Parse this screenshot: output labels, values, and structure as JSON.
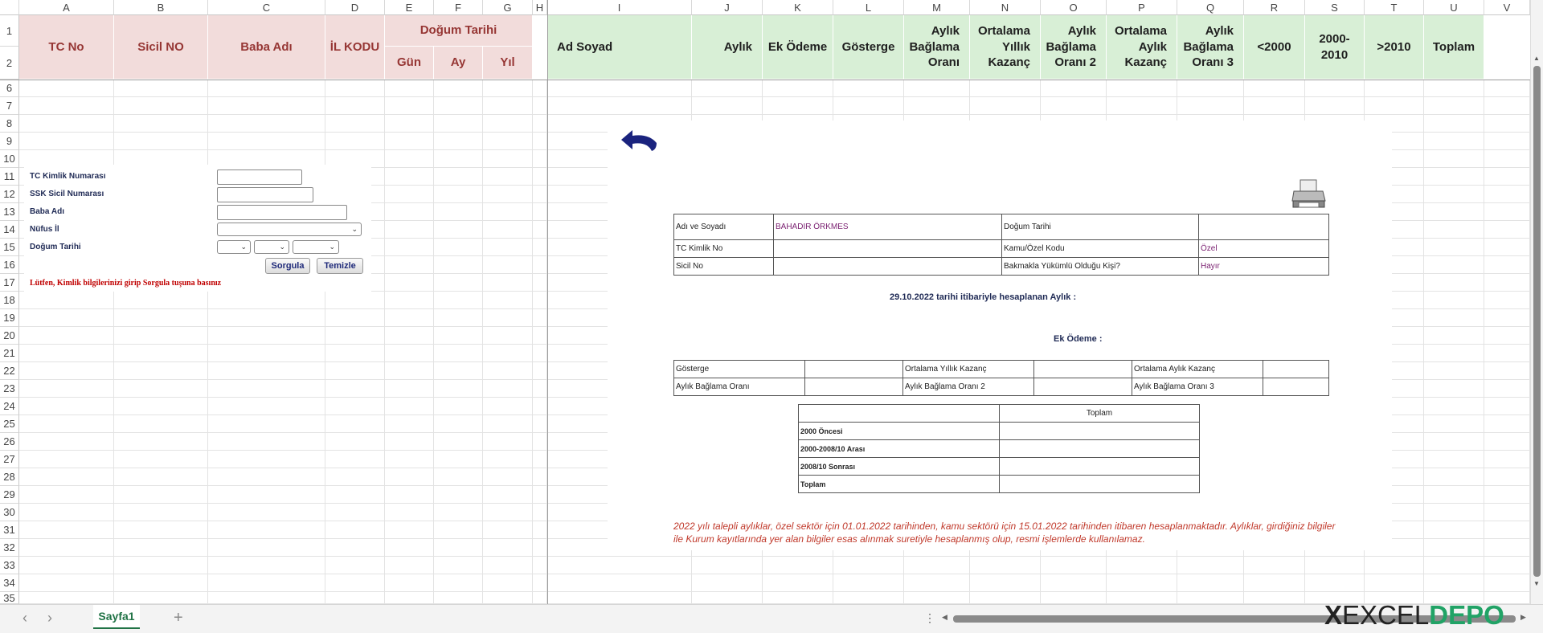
{
  "columns": [
    "A",
    "B",
    "C",
    "D",
    "E",
    "F",
    "G",
    "H",
    "I",
    "J",
    "K",
    "L",
    "M",
    "N",
    "O",
    "P",
    "Q",
    "R",
    "S",
    "T",
    "U",
    "V"
  ],
  "rows": [
    "1",
    "2",
    "6",
    "7",
    "8",
    "9",
    "10",
    "11",
    "12",
    "13",
    "14",
    "15",
    "16",
    "17",
    "18",
    "19",
    "20",
    "21",
    "22",
    "23",
    "24",
    "25",
    "26",
    "27",
    "28",
    "29",
    "30",
    "31",
    "32",
    "33",
    "34",
    "35"
  ],
  "headers": {
    "tc_no": "TC No",
    "sicil_no": "Sicil NO",
    "baba_adi": "Baba Adı",
    "il_kodu": "İL KODU",
    "dogum_tarihi": "Doğum Tarihi",
    "gun": "Gün",
    "ay": "Ay",
    "yil": "Yıl",
    "ad_soyad": "Ad Soyad",
    "aylik": "Aylık",
    "ek_odeme": "Ek Ödeme",
    "gosterge": "Gösterge",
    "aylik_baglama_orani": "Aylık Bağlama Oranı",
    "ortalama_yillik_kazanc": "Ortalama Yıllık Kazanç",
    "aylik_baglama_orani_2": "Aylık Bağlama Oranı 2",
    "ortalama_aylik_kazanc": "Ortalama Aylık Kazanç",
    "aylik_baglama_orani_3": "Aylık Bağlama Oranı 3",
    "lt2000": "<2000",
    "r2000_2010": "2000-2010",
    "gt2010": ">2010",
    "toplam": "Toplam"
  },
  "form": {
    "tc_label": "TC Kimlik Numarası",
    "ssk_label": "SSK Sicil Numarası",
    "baba_label": "Baba Adı",
    "nufus_label": "Nüfus İl",
    "dogum_label": "Doğum Tarihi",
    "sorgula": "Sorgula",
    "temizle": "Temizle",
    "hint": "Lütfen, Kimlik bilgilerinizi girip Sorgula tuşuna basınız",
    "dropdown_arrow": "⌄"
  },
  "report": {
    "ad_soyad_label": "Adı ve Soyadı",
    "ad_soyad_value": "BAHADIR ÖRKMES",
    "dogum_tarihi_label": "Doğum Tarihi",
    "tc_label": "TC Kimlik No",
    "kamu_ozel_label": "Kamu/Özel Kodu",
    "kamu_ozel_value": "Özel",
    "sicil_label": "Sicil No",
    "bakmakla_label": "Bakmakla Yükümlü Olduğu Kişi?",
    "bakmakla_value": "Hayır",
    "aylik_line": "29.10.2022 tarihi itibariyle hesaplanan Aylık :",
    "ek_odeme_line": "Ek Ödeme :",
    "gosterge": "Gösterge",
    "ortalama_yillik": "Ortalama Yıllık Kazanç",
    "ortalama_aylik": "Ortalama Aylık Kazanç",
    "abo": "Aylık Bağlama Oranı",
    "abo2": "Aylık Bağlama Oranı 2",
    "abo3": "Aylık Bağlama Oranı 3",
    "toplam_header": "Toplam",
    "r1": "2000 Öncesi",
    "r2": "2000-2008/10 Arası",
    "r3": "2008/10 Sonrası",
    "r4": "Toplam",
    "note": "2022 yılı talepli aylıklar, özel sektör için 01.01.2022 tarihinden, kamu sektörü için 15.01.2022 tarihinden itibaren hesaplanmaktadır. Aylıklar, girdiğiniz bilgiler ile Kurum kayıtlarında yer alan bilgiler esas alınmak suretiyle hesaplanmış olup, resmi işlemlerde kullanılamaz."
  },
  "sheet": {
    "tab": "Sayfa1",
    "add": "+",
    "more": "⋮",
    "nav_prev": "‹",
    "nav_next": "›",
    "scroll_left": "◀",
    "scroll_right": "▶",
    "scroll_up": "▲",
    "scroll_down": "▼"
  },
  "logo": {
    "x": "X",
    "excel": "EXCEL",
    "depo": "DEPO"
  },
  "colors": {
    "pink": "#f2dcdb",
    "green": "#d8efd6",
    "accent": "#217346",
    "navy": "#1f2a55"
  }
}
